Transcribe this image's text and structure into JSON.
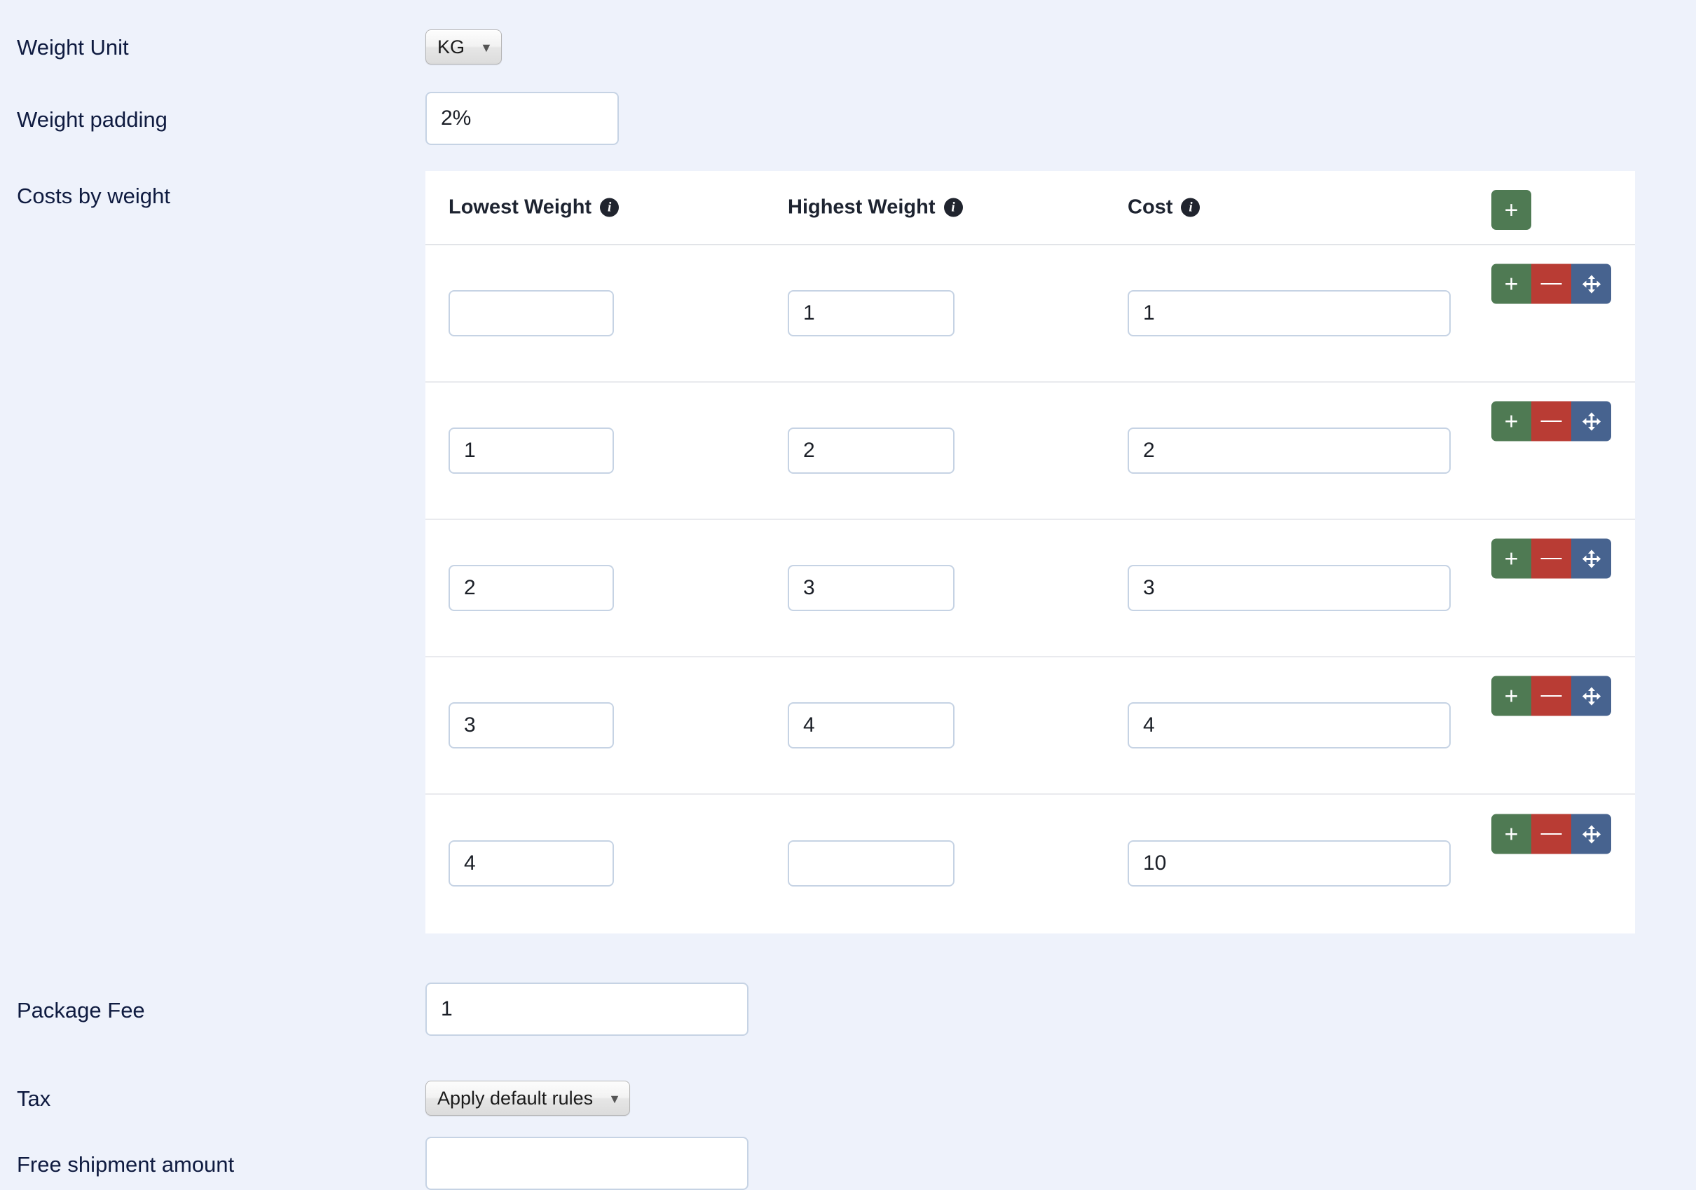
{
  "form": {
    "weight_unit": {
      "label": "Weight Unit",
      "value": "KG",
      "caret": "▼"
    },
    "weight_padding": {
      "label": "Weight padding",
      "value": "2%"
    },
    "costs_by_weight": {
      "label": "Costs by weight",
      "add_row_label": "+",
      "columns": [
        {
          "header": "Lowest Weight",
          "info": "i"
        },
        {
          "header": "Highest Weight",
          "info": "i"
        },
        {
          "header": "Cost",
          "info": "i"
        }
      ],
      "row_actions": {
        "add_label": "+",
        "remove_label": "—",
        "move_label": "move"
      },
      "rows": [
        {
          "lowest_weight": "",
          "highest_weight": "1",
          "cost": "1"
        },
        {
          "lowest_weight": "1",
          "highest_weight": "2",
          "cost": "2"
        },
        {
          "lowest_weight": "2",
          "highest_weight": "3",
          "cost": "3"
        },
        {
          "lowest_weight": "3",
          "highest_weight": "4",
          "cost": "4"
        },
        {
          "lowest_weight": "4",
          "highest_weight": "",
          "cost": "10"
        }
      ]
    },
    "package_fee": {
      "label": "Package Fee",
      "value": "1"
    },
    "tax": {
      "label": "Tax",
      "value": "Apply default rules",
      "caret": "▼"
    },
    "free_shipment_amount": {
      "label": "Free shipment amount",
      "value": ""
    }
  },
  "colors": {
    "background": "#eef2fb",
    "label_text": "#0f1b40",
    "panel": "#ffffff",
    "input_border": "#c6d3e4",
    "action_add": "#4f7a53",
    "action_remove": "#b93c34",
    "action_move": "#47638f",
    "info_badge": "#20242e"
  }
}
